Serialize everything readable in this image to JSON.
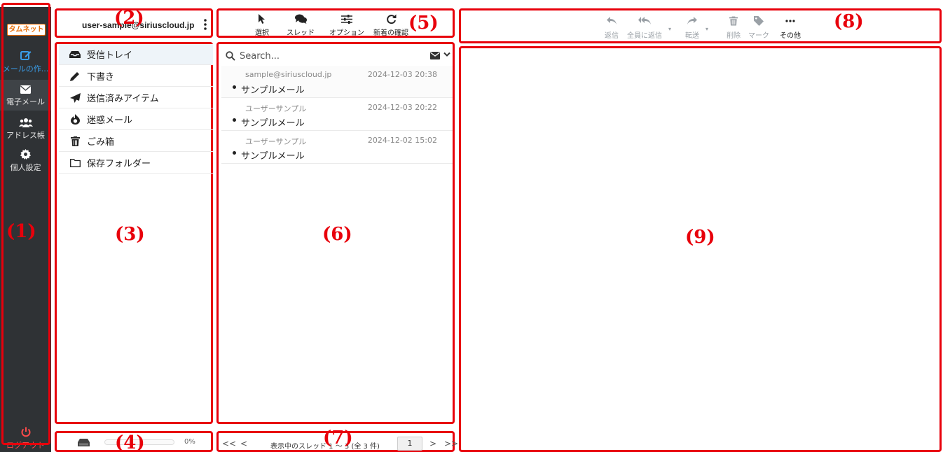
{
  "nav": {
    "logo": "タムネット",
    "items": [
      {
        "icon": "compose-icon",
        "label": "メールの作..."
      },
      {
        "icon": "envelope-icon",
        "label": "電子メール"
      },
      {
        "icon": "users-icon",
        "label": "アドレス帳"
      },
      {
        "icon": "gear-icon",
        "label": "個人設定"
      }
    ],
    "logout": {
      "icon": "power-icon",
      "label": "ログアウト"
    }
  },
  "account": {
    "email": "user-sample@siriuscloud.jp",
    "menu_icon": "kebab-menu-icon"
  },
  "folders": [
    {
      "icon": "inbox-icon",
      "label": "受信トレイ"
    },
    {
      "icon": "pencil-icon",
      "label": "下書き"
    },
    {
      "icon": "paper-plane-icon",
      "label": "送信済みアイテム"
    },
    {
      "icon": "fire-icon",
      "label": "迷惑メール"
    },
    {
      "icon": "trash-icon",
      "label": "ごみ箱"
    },
    {
      "icon": "folder-icon",
      "label": "保存フォルダー"
    }
  ],
  "quota": {
    "icon": "drive-icon",
    "percent_label": "0%",
    "usage_fraction": 0
  },
  "list_toolbar": [
    {
      "icon": "cursor-icon",
      "label": "選択"
    },
    {
      "icon": "comments-icon",
      "label": "スレッド"
    },
    {
      "icon": "sliders-icon",
      "label": "オプション"
    },
    {
      "icon": "refresh-icon",
      "label": "新着の確認"
    }
  ],
  "search": {
    "placeholder": "Search..."
  },
  "messages": [
    {
      "from": "sample@siriuscloud.jp",
      "date": "2024-12-03 20:38",
      "subject": "サンプルメール"
    },
    {
      "from": "ユーザーサンプル",
      "date": "2024-12-03 20:22",
      "subject": "サンプルメール"
    },
    {
      "from": "ユーザーサンプル",
      "date": "2024-12-02 15:02",
      "subject": "サンプルメール"
    }
  ],
  "pagination": {
    "first": "<<",
    "prev": "<",
    "next": ">",
    "last": ">>",
    "info": "表示中のスレッド 1 ～ 3 (全 3 件)",
    "page": "1"
  },
  "message_toolbar": [
    {
      "icon": "reply-icon",
      "label": "返信"
    },
    {
      "icon": "reply-all-icon",
      "label": "全員に返信"
    },
    {
      "icon": "forward-icon",
      "label": "転送"
    },
    {
      "icon": "trash-icon",
      "label": "削除"
    },
    {
      "icon": "tag-icon",
      "label": "マーク"
    },
    {
      "icon": "more-icon",
      "label": "その他"
    }
  ],
  "annotations": [
    "(1)",
    "(2)",
    "(3)",
    "(4)",
    "(5)",
    "(6)",
    "(7)",
    "(8)",
    "(9)"
  ],
  "colors": {
    "rail": "#2f3235",
    "accent": "#3a9eea",
    "annotation": "#e8000b",
    "logout": "#ff4a4a",
    "logo": "#e56a00"
  }
}
